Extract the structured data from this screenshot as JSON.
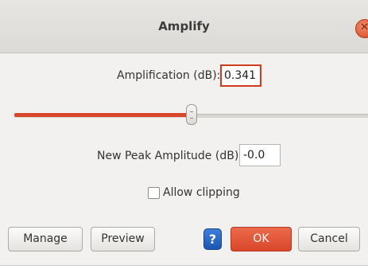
{
  "window": {
    "title": "Amplify"
  },
  "amplification": {
    "label": "Amplification (dB):",
    "value": "0.341"
  },
  "slider": {
    "level_percent": 50
  },
  "new_peak": {
    "label": "New Peak Amplitude (dB):",
    "value": "-0.0"
  },
  "clipping": {
    "label": "Allow clipping",
    "checked": false
  },
  "buttons": {
    "manage": "Manage",
    "preview": "Preview",
    "help": "?",
    "ok": "OK",
    "cancel": "Cancel"
  },
  "colors": {
    "accent": "#d9472a",
    "help": "#1c56b0"
  }
}
